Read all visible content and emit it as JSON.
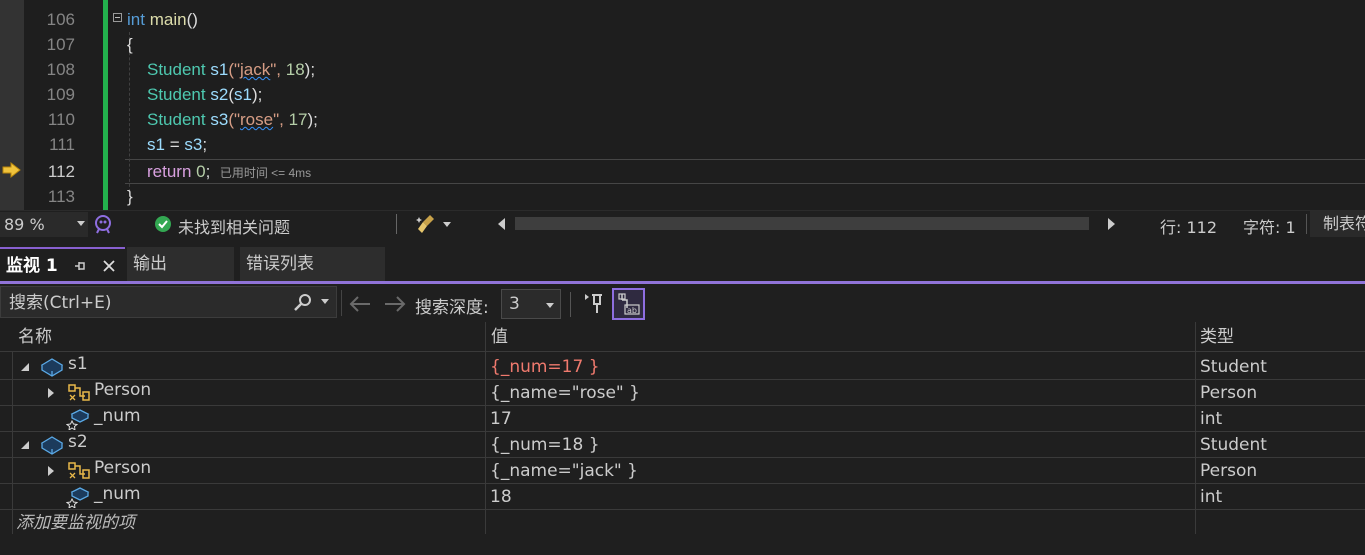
{
  "editor": {
    "lines": [
      {
        "num": "106"
      },
      {
        "num": "107"
      },
      {
        "num": "108"
      },
      {
        "num": "109"
      },
      {
        "num": "110"
      },
      {
        "num": "111"
      },
      {
        "num": "112"
      },
      {
        "num": "113"
      }
    ],
    "code": {
      "l106": {
        "kw": "int",
        "fn": "main",
        "rest": "()"
      },
      "l107": "{",
      "l108": {
        "ty": "Student",
        "var": "s1",
        "open": "(\"",
        "str": "jack",
        "mid": "\", ",
        "num": "18",
        "end": ");"
      },
      "l109": {
        "ty": "Student",
        "var": "s2",
        "open": "(",
        "arg": "s1",
        "end": ");"
      },
      "l110": {
        "ty": "Student",
        "var": "s3",
        "open": "(\"",
        "str": "rose",
        "mid": "\", ",
        "num": "17",
        "end": ");"
      },
      "l111": {
        "lhs": "s1",
        "op": " = ",
        "rhs": "s3",
        "end": ";"
      },
      "l112": {
        "kw": "return",
        "num": "0",
        "end": ";"
      },
      "l113": "}"
    },
    "elapsed": "已用时间 <= 4ms",
    "current_line": "112"
  },
  "status": {
    "zoom": "89 %",
    "issues": "未找到相关问题",
    "line": "行: 112",
    "col": "字符: 1",
    "tabs": "制表符"
  },
  "tabs": {
    "watch": "监视 1",
    "output": "输出",
    "errors": "错误列表"
  },
  "toolbar": {
    "search_placeholder": "搜索(Ctrl+E)",
    "depth_label": "搜索深度:",
    "depth_value": "3"
  },
  "grid": {
    "headers": {
      "name": "名称",
      "value": "值",
      "type": "类型"
    },
    "rows": [
      {
        "name": "s1",
        "value": "{_num=17 }",
        "type": "Student"
      },
      {
        "name": "Person",
        "value": "{_name=\"rose\" }",
        "type": "Person"
      },
      {
        "name": "_num",
        "value": "17",
        "type": "int"
      },
      {
        "name": "s2",
        "value": "{_num=18 }",
        "type": "Student"
      },
      {
        "name": "Person",
        "value": "{_name=\"jack\" }",
        "type": "Person"
      },
      {
        "name": "_num",
        "value": "18",
        "type": "int"
      }
    ],
    "add_item": "添加要监视的项"
  },
  "colors": {
    "accent": "#9073d8",
    "change_bar": "#23b14d",
    "changed_value": "#f07a6e",
    "success": "#33a852"
  }
}
